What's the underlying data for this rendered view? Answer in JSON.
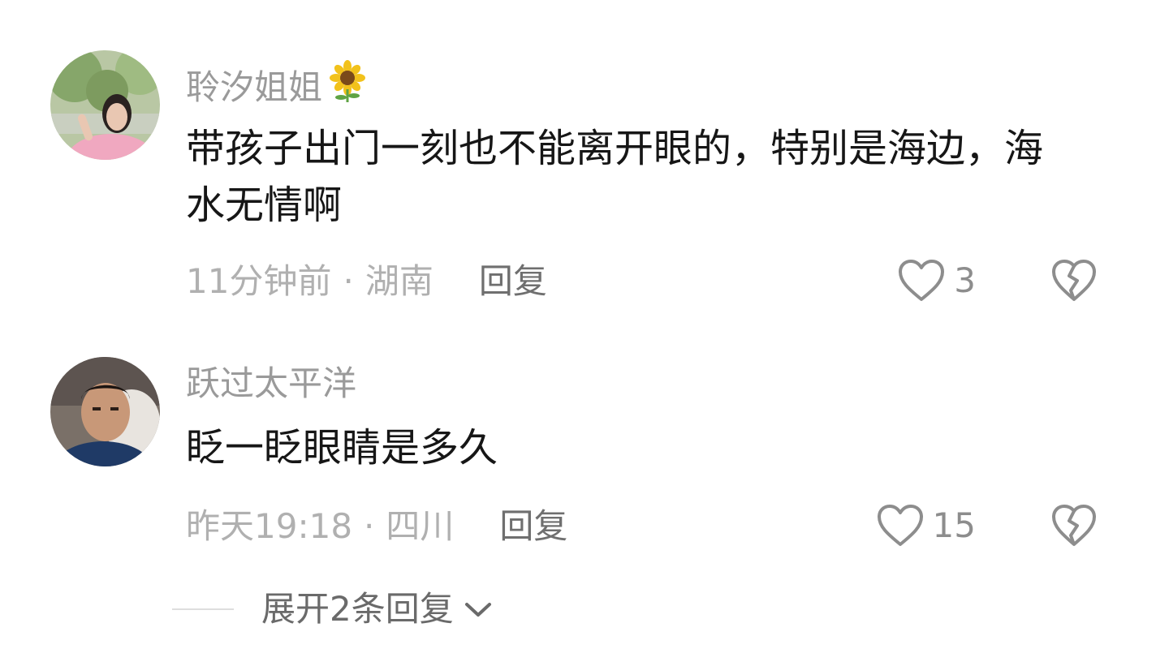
{
  "comments": [
    {
      "username": "聆汐姐姐",
      "username_icon": "sunflower-icon",
      "text": "带孩子出门一刻也不能离开眼的，特别是海边，海水无情啊",
      "time": "11分钟前",
      "separator": "·",
      "location": "湖南",
      "reply_label": "回复",
      "like_count": "3",
      "like_icon": "heart-outline-icon",
      "dislike_icon": "broken-heart-icon"
    },
    {
      "username": "跃过太平洋",
      "text": "眨一眨眼睛是多久",
      "time": "昨天19:18",
      "separator": "·",
      "location": "四川",
      "reply_label": "回复",
      "like_count": "15",
      "like_icon": "heart-outline-icon",
      "dislike_icon": "broken-heart-icon"
    }
  ],
  "expand_replies": {
    "label": "展开2条回复",
    "icon": "chevron-down-icon"
  },
  "colors": {
    "username": "#9a9a9a",
    "text": "#161616",
    "meta": "#b0b0b0",
    "icons": "#8d8d8d"
  }
}
